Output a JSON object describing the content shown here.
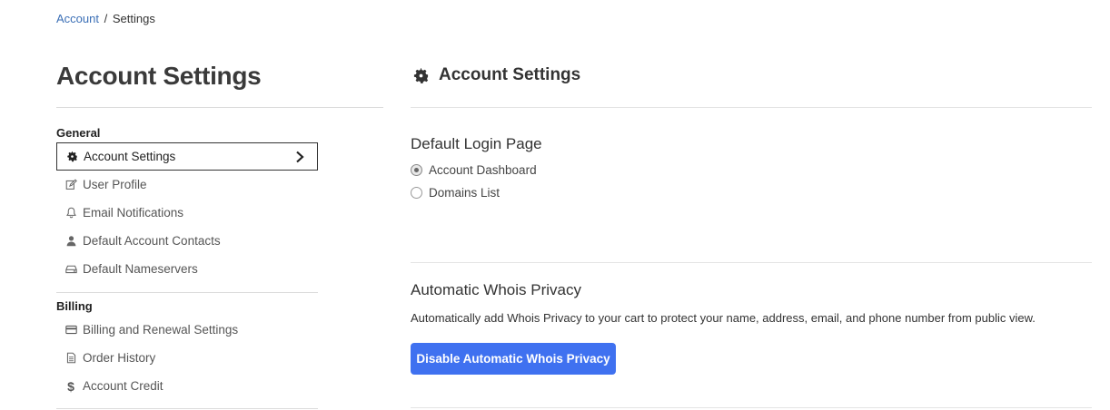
{
  "breadcrumb": {
    "link": "Account",
    "separator": "/",
    "current": "Settings"
  },
  "sidebar": {
    "title": "Account Settings",
    "sections": [
      {
        "label": "General",
        "items": [
          {
            "label": "Account Settings",
            "icon": "gear-icon",
            "active": true
          },
          {
            "label": "User Profile",
            "icon": "edit-icon",
            "active": false
          },
          {
            "label": "Email Notifications",
            "icon": "bell-icon",
            "active": false
          },
          {
            "label": "Default Account Contacts",
            "icon": "user-icon",
            "active": false
          },
          {
            "label": "Default Nameservers",
            "icon": "server-icon",
            "active": false
          }
        ]
      },
      {
        "label": "Billing",
        "items": [
          {
            "label": "Billing and Renewal Settings",
            "icon": "credit-card-icon",
            "active": false
          },
          {
            "label": "Order History",
            "icon": "document-icon",
            "active": false
          },
          {
            "label": "Account Credit",
            "icon": "dollar-icon",
            "active": false
          }
        ]
      }
    ]
  },
  "main": {
    "title": "Account Settings",
    "title_icon": "gear-icon",
    "login_page": {
      "heading": "Default Login Page",
      "options": [
        {
          "label": "Account Dashboard",
          "checked": true
        },
        {
          "label": "Domains List",
          "checked": false
        }
      ]
    },
    "whois": {
      "heading": "Automatic Whois Privacy",
      "description": "Automatically add Whois Privacy to your cart to protect your name, address, email, and phone number from public view.",
      "button_label": "Disable Automatic Whois Privacy"
    }
  },
  "colors": {
    "link": "#3b6fb6",
    "primary_button": "#3f71f0",
    "text": "#333333",
    "divider": "#dcdcdc"
  }
}
